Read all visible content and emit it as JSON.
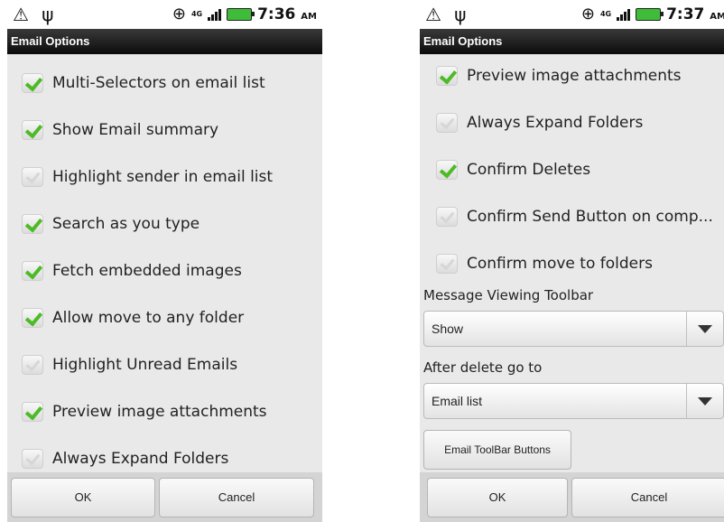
{
  "left": {
    "status": {
      "time": "7:36",
      "ampm": "AM",
      "network": "4G"
    },
    "title": "Email Options",
    "options": [
      {
        "label": "Multi-Selectors on email list",
        "checked": true
      },
      {
        "label": "Show Email summary",
        "checked": true
      },
      {
        "label": "Highlight sender in email list",
        "checked": false
      },
      {
        "label": "Search as you type",
        "checked": true
      },
      {
        "label": "Fetch embedded images",
        "checked": true
      },
      {
        "label": "Allow move to any folder",
        "checked": true
      },
      {
        "label": "Highlight Unread Emails",
        "checked": false
      },
      {
        "label": "Preview image attachments",
        "checked": true
      },
      {
        "label": "Always Expand Folders",
        "checked": false
      }
    ],
    "ok_label": "OK",
    "cancel_label": "Cancel"
  },
  "right": {
    "status": {
      "time": "7:37",
      "ampm": "AM",
      "network": "4G"
    },
    "title": "Email Options",
    "options": [
      {
        "label": "Preview image attachments",
        "checked": true
      },
      {
        "label": "Always Expand Folders",
        "checked": false
      },
      {
        "label": "Confirm Deletes",
        "checked": true
      },
      {
        "label": "Confirm Send Button on comp...",
        "checked": false
      },
      {
        "label": "Confirm move to folders",
        "checked": false
      }
    ],
    "message_toolbar_label": "Message Viewing Toolbar",
    "message_toolbar_value": "Show",
    "after_delete_label": "After delete go to",
    "after_delete_value": "Email list",
    "toolbar_buttons_label": "Email ToolBar Buttons",
    "ok_label": "OK",
    "cancel_label": "Cancel"
  },
  "colors": {
    "accent_check": "#4cbb25",
    "titlebar": "#1a1a1a"
  }
}
